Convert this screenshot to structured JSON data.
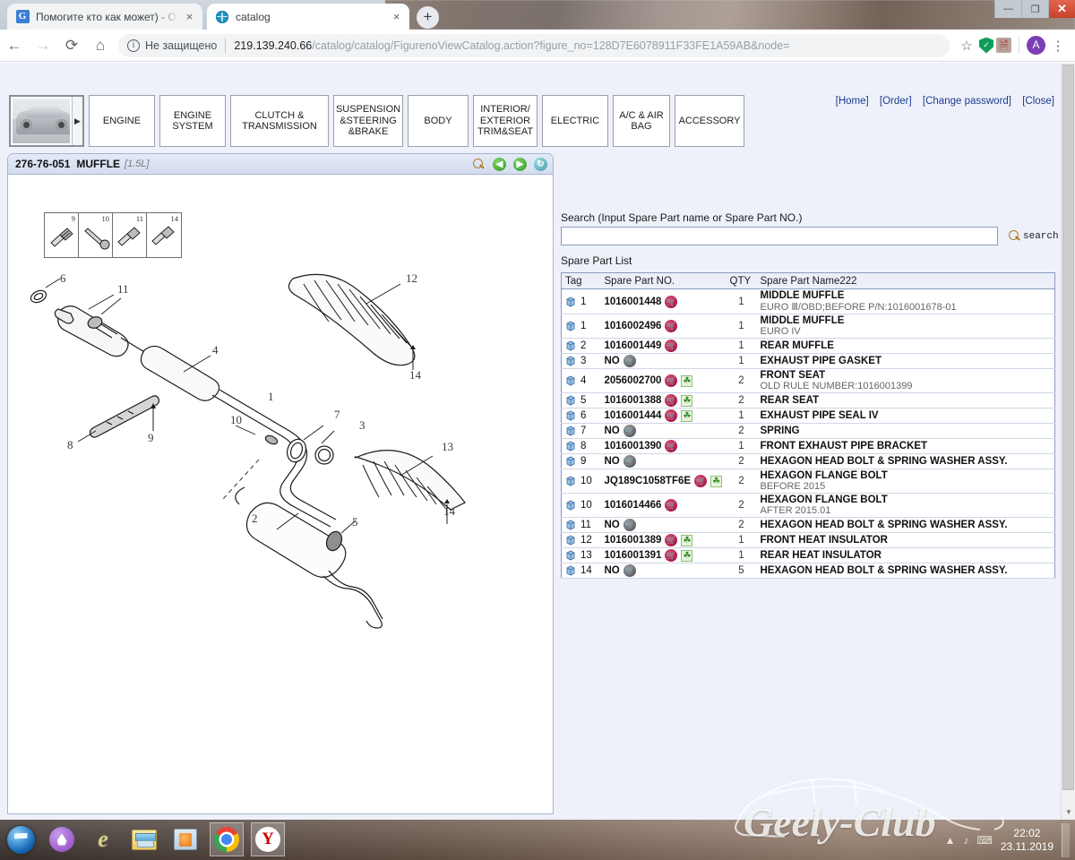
{
  "browser": {
    "tabs": [
      {
        "title": "Помогите кто как может) - Отзы",
        "favicon": "g-logo-icon",
        "active": false,
        "close_label": "×"
      },
      {
        "title": "catalog",
        "favicon": "globe-icon",
        "active": true,
        "close_label": "×"
      }
    ],
    "new_tab_label": "+",
    "window_controls": {
      "minimize": "—",
      "maximize": "❐",
      "close": "✕"
    },
    "nav": {
      "back": "←",
      "forward": "→",
      "reload": "⟳",
      "home": "⌂"
    },
    "omnibox": {
      "security_label": "Не защищено",
      "url_host": "219.139.240.66",
      "url_path": "/catalog/catalog/FigurenoViewCatalog.action?figure_no=128D7E6078911F33FE1A59AB&node=",
      "star": "☆"
    },
    "extensions": {
      "shield": "shield-icon",
      "pdf": "adobe-pdf-icon",
      "avatar_letter": "A",
      "menu": "⋮"
    }
  },
  "catalog": {
    "vehicle_thumb_arrow": "▶",
    "categories": [
      {
        "label": "ENGINE"
      },
      {
        "label": "ENGINE\nSYSTEM"
      },
      {
        "label": "CLUTCH &\nTRANSMISSION"
      },
      {
        "label": "SUSPENSION\n&STEERING\n&BRAKE"
      },
      {
        "label": "BODY"
      },
      {
        "label": "INTERIOR/\nEXTERIOR\nTRIM&SEAT"
      },
      {
        "label": "ELECTRIC"
      },
      {
        "label": "A/C & AIR\nBAG"
      },
      {
        "label": "ACCESSORY"
      }
    ],
    "top_links": [
      "[Home]",
      "[Order]",
      "[Change password]",
      "[Close]"
    ]
  },
  "figure": {
    "number": "276-76-051",
    "name": "MUFFLE",
    "engine": "[1.5L]",
    "caption": "1.5L",
    "tools": {
      "zoom": "zoom-in-icon",
      "prev": "◀",
      "next": "▶",
      "refresh": "↻"
    },
    "thumbnails": [
      {
        "number": "9"
      },
      {
        "number": "10"
      },
      {
        "number": "11"
      },
      {
        "number": "14"
      }
    ],
    "callouts": [
      "1",
      "2",
      "3",
      "4",
      "5",
      "6",
      "7",
      "8",
      "9",
      "10",
      "11",
      "12",
      "13",
      "14"
    ]
  },
  "search": {
    "label": "Search (Input Spare Part name or Spare Part NO.)",
    "value": "",
    "placeholder": "",
    "button_label": "search"
  },
  "parts": {
    "list_label": "Spare Part List",
    "columns": [
      "Tag",
      "Spare Part NO.",
      "QTY",
      "Spare Part Name222"
    ],
    "rows": [
      {
        "tag": "1",
        "part_no": "1016001448",
        "icons": [
          "cart"
        ],
        "qty": "1",
        "name": "MIDDLE MUFFLE",
        "note": "EURO Ⅲ/OBD;BEFORE P/N:1016001678-01"
      },
      {
        "tag": "1",
        "part_no": "1016002496",
        "icons": [
          "cart"
        ],
        "qty": "1",
        "name": "MIDDLE MUFFLE",
        "note": "EURO IV"
      },
      {
        "tag": "2",
        "part_no": "1016001449",
        "icons": [
          "cart"
        ],
        "qty": "1",
        "name": "REAR MUFFLE",
        "note": ""
      },
      {
        "tag": "3",
        "part_no": "NO",
        "icons": [
          "cart-grey"
        ],
        "qty": "1",
        "name": "EXHAUST PIPE GASKET",
        "note": ""
      },
      {
        "tag": "4",
        "part_no": "2056002700",
        "icons": [
          "cart",
          "leaf"
        ],
        "qty": "2",
        "name": "FRONT SEAT",
        "note": "OLD RULE NUMBER:1016001399"
      },
      {
        "tag": "5",
        "part_no": "1016001388",
        "icons": [
          "cart",
          "leaf"
        ],
        "qty": "2",
        "name": "REAR SEAT",
        "note": ""
      },
      {
        "tag": "6",
        "part_no": "1016001444",
        "icons": [
          "cart",
          "leaf"
        ],
        "qty": "1",
        "name": "EXHAUST PIPE SEAL IV",
        "note": ""
      },
      {
        "tag": "7",
        "part_no": "NO",
        "icons": [
          "cart-grey"
        ],
        "qty": "2",
        "name": "SPRING",
        "note": ""
      },
      {
        "tag": "8",
        "part_no": "1016001390",
        "icons": [
          "cart"
        ],
        "qty": "1",
        "name": "FRONT EXHAUST PIPE BRACKET",
        "note": ""
      },
      {
        "tag": "9",
        "part_no": "NO",
        "icons": [
          "cart-grey"
        ],
        "qty": "2",
        "name": "HEXAGON HEAD BOLT & SPRING WASHER ASSY.",
        "note": ""
      },
      {
        "tag": "10",
        "part_no": "JQ189C1058TF6E",
        "icons": [
          "cart",
          "leaf"
        ],
        "qty": "2",
        "name": "HEXAGON FLANGE BOLT",
        "note": "BEFORE 2015"
      },
      {
        "tag": "10",
        "part_no": "1016014466",
        "icons": [
          "cart"
        ],
        "qty": "2",
        "name": "HEXAGON FLANGE BOLT",
        "note": "AFTER 2015.01"
      },
      {
        "tag": "11",
        "part_no": "NO",
        "icons": [
          "cart-grey"
        ],
        "qty": "2",
        "name": "HEXAGON HEAD BOLT & SPRING WASHER ASSY.",
        "note": ""
      },
      {
        "tag": "12",
        "part_no": "1016001389",
        "icons": [
          "cart",
          "leaf"
        ],
        "qty": "1",
        "name": "FRONT HEAT INSULATOR",
        "note": ""
      },
      {
        "tag": "13",
        "part_no": "1016001391",
        "icons": [
          "cart",
          "leaf"
        ],
        "qty": "1",
        "name": "REAR HEAT INSULATOR",
        "note": ""
      },
      {
        "tag": "14",
        "part_no": "NO",
        "icons": [
          "cart-grey"
        ],
        "qty": "5",
        "name": "HEXAGON HEAD BOLT & SPRING WASHER ASSY.",
        "note": ""
      }
    ]
  },
  "taskbar": {
    "items": [
      {
        "name": "start-button",
        "icon": "windows-start-icon"
      },
      {
        "name": "yandex-disk-button",
        "icon": "yandex-disk-icon"
      },
      {
        "name": "internet-explorer-button",
        "icon": "internet-explorer-icon"
      },
      {
        "name": "file-explorer-button",
        "icon": "folder-icon"
      },
      {
        "name": "media-player-button",
        "icon": "media-player-icon"
      },
      {
        "name": "chrome-button",
        "icon": "chrome-icon",
        "boxed": true
      },
      {
        "name": "yandex-browser-button",
        "icon": "yandex-icon",
        "boxed": true
      }
    ],
    "tray": {
      "show_hidden": "▲",
      "volume": "♪",
      "network": "⌨"
    },
    "clock_time": "22:02",
    "clock_date": "23.11.2019"
  },
  "watermark": {
    "text": "Geely-Club"
  },
  "colors": {
    "accent_blue": "#1a3c8c",
    "panel_bg": "#eef1fa",
    "cart_red": "#a4003c",
    "leaf_green": "#2f8a20",
    "close_red": "#c9412a"
  }
}
